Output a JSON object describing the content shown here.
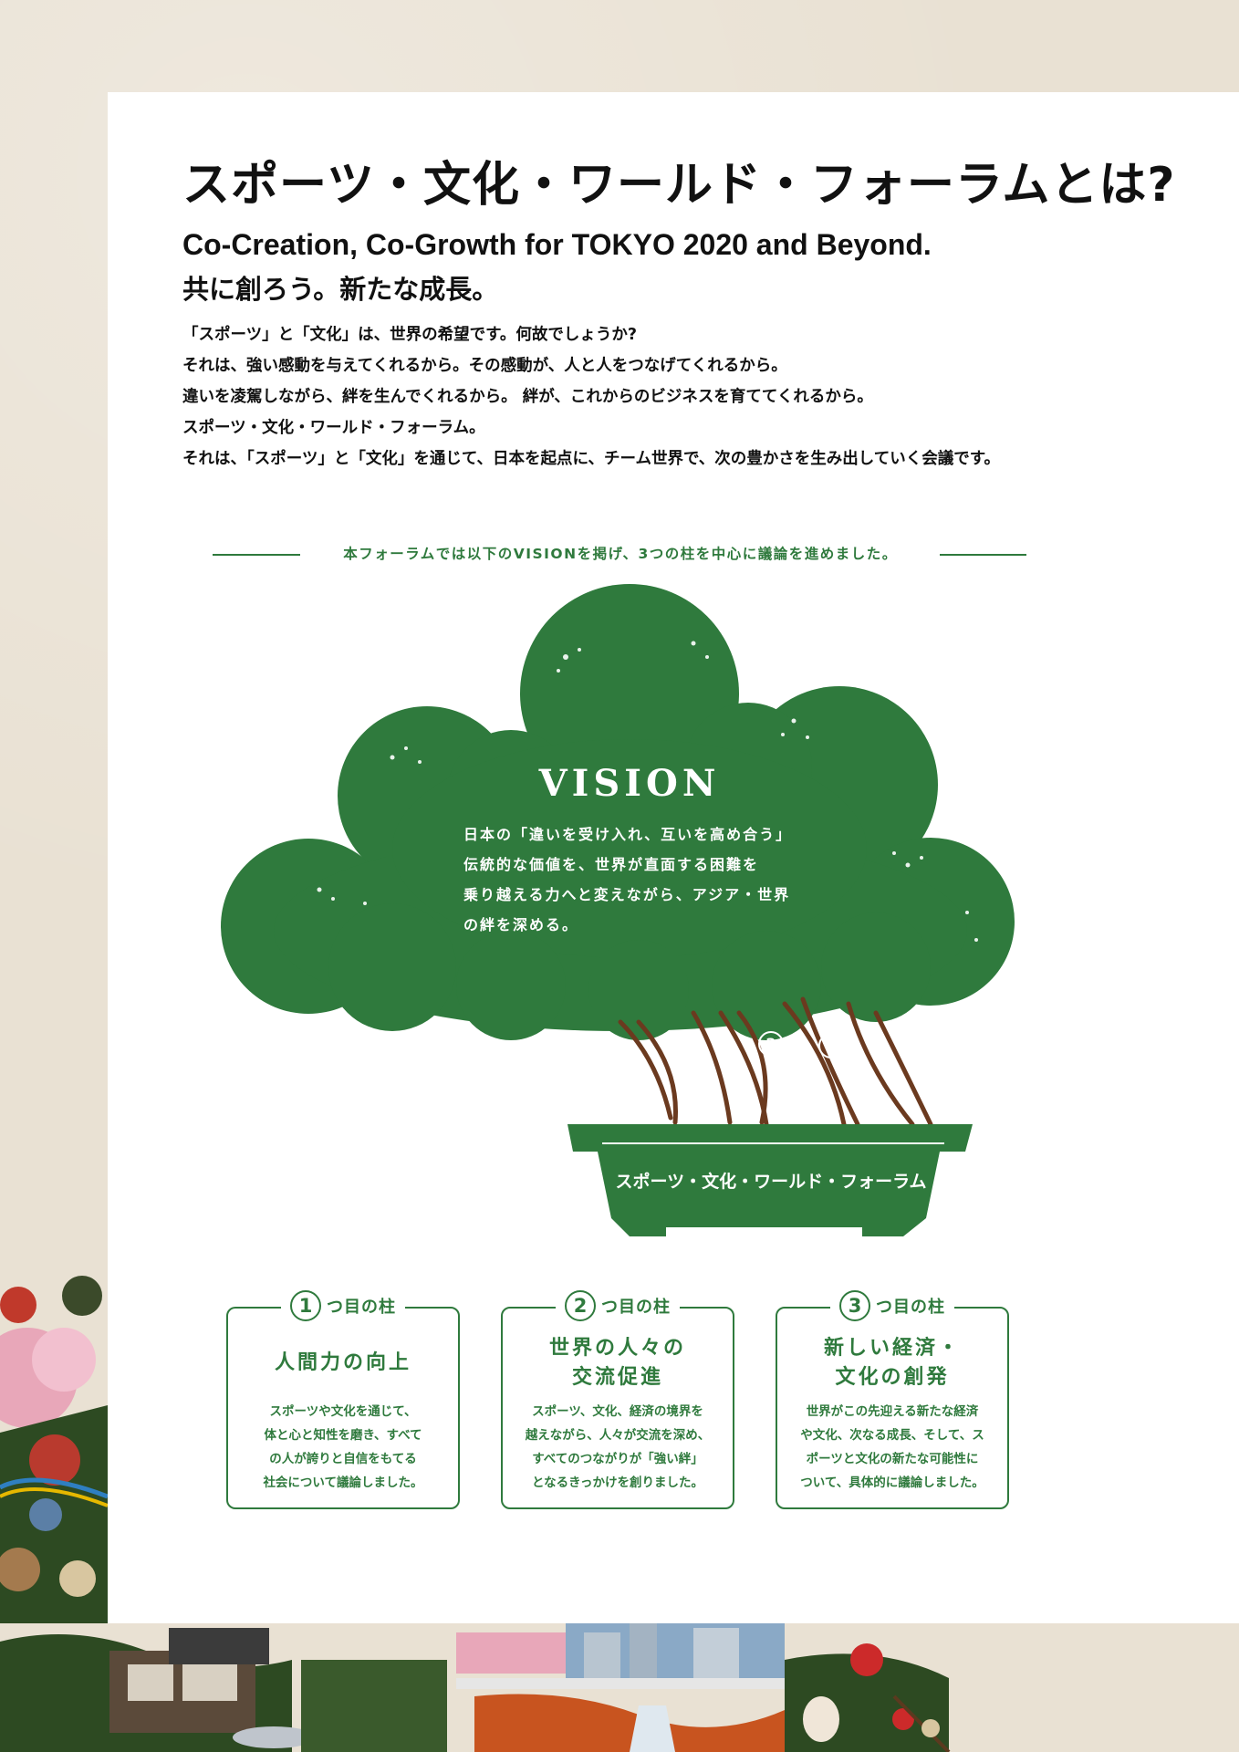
{
  "title": "スポーツ・文化・ワールド・フォーラムとは?",
  "subtitle_en": "Co-Creation, Co-Growth for TOKYO 2020 and Beyond.",
  "subtitle_ja": "共に創ろう。新たな成長。",
  "intro": [
    "「スポーツ」と「文化」は、世界の希望です。何故でしょうか?",
    "それは、強い感動を与えてくれるから。その感動が、人と人をつなげてくれるから。",
    "違いを凌駕しながら、絆を生んでくれるから。 絆が、これからのビジネスを育ててくれるから。",
    "スポーツ・文化・ワールド・フォーラム。",
    "それは、「スポーツ」と「文化」を通じて、日本を起点に、チーム世界で、次の豊かさを生み出していく会議です。"
  ],
  "divider_text": "本フォーラムでは以下のVISIONを掲げ、3つの柱を中心に議論を進めました。",
  "vision": {
    "title": "VISION",
    "lines": [
      "日本の「違いを受け入れ、互いを高め合う」",
      "伝統的な価値を、世界が直面する困難を",
      "乗り越える力へと変えながら、アジア・世界",
      "の絆を深める。"
    ]
  },
  "tree_numbers": [
    "1",
    "2",
    "3"
  ],
  "pot_label": "スポーツ・文化・ワールド・フォーラム",
  "pillar_suffix": "つ目の柱",
  "pillars": [
    {
      "num": "1",
      "heading": [
        "人間力の向上"
      ],
      "desc": [
        "スポーツや文化を通じて、",
        "体と心と知性を磨き、すべて",
        "の人が誇りと自信をもてる",
        "社会について議論しました。"
      ]
    },
    {
      "num": "2",
      "heading": [
        "世界の人々の",
        "交流促進"
      ],
      "desc": [
        "スポーツ、文化、経済の境界を",
        "越えながら、人々が交流を深め、",
        "すべてのつながりが「強い絆」",
        "となるきっかけを創りました。"
      ]
    },
    {
      "num": "3",
      "heading": [
        "新しい経済・",
        "文化の創発"
      ],
      "desc": [
        "世界がこの先迎える新たな経済",
        "や文化、次なる成長、そして、ス",
        "ポーツと文化の新たな可能性に",
        "ついて、具体的に議論しました。"
      ]
    }
  ],
  "colors": {
    "green": "#2f7a3d",
    "trunk": "#6b3a1f",
    "background": "#e9e1d3"
  }
}
